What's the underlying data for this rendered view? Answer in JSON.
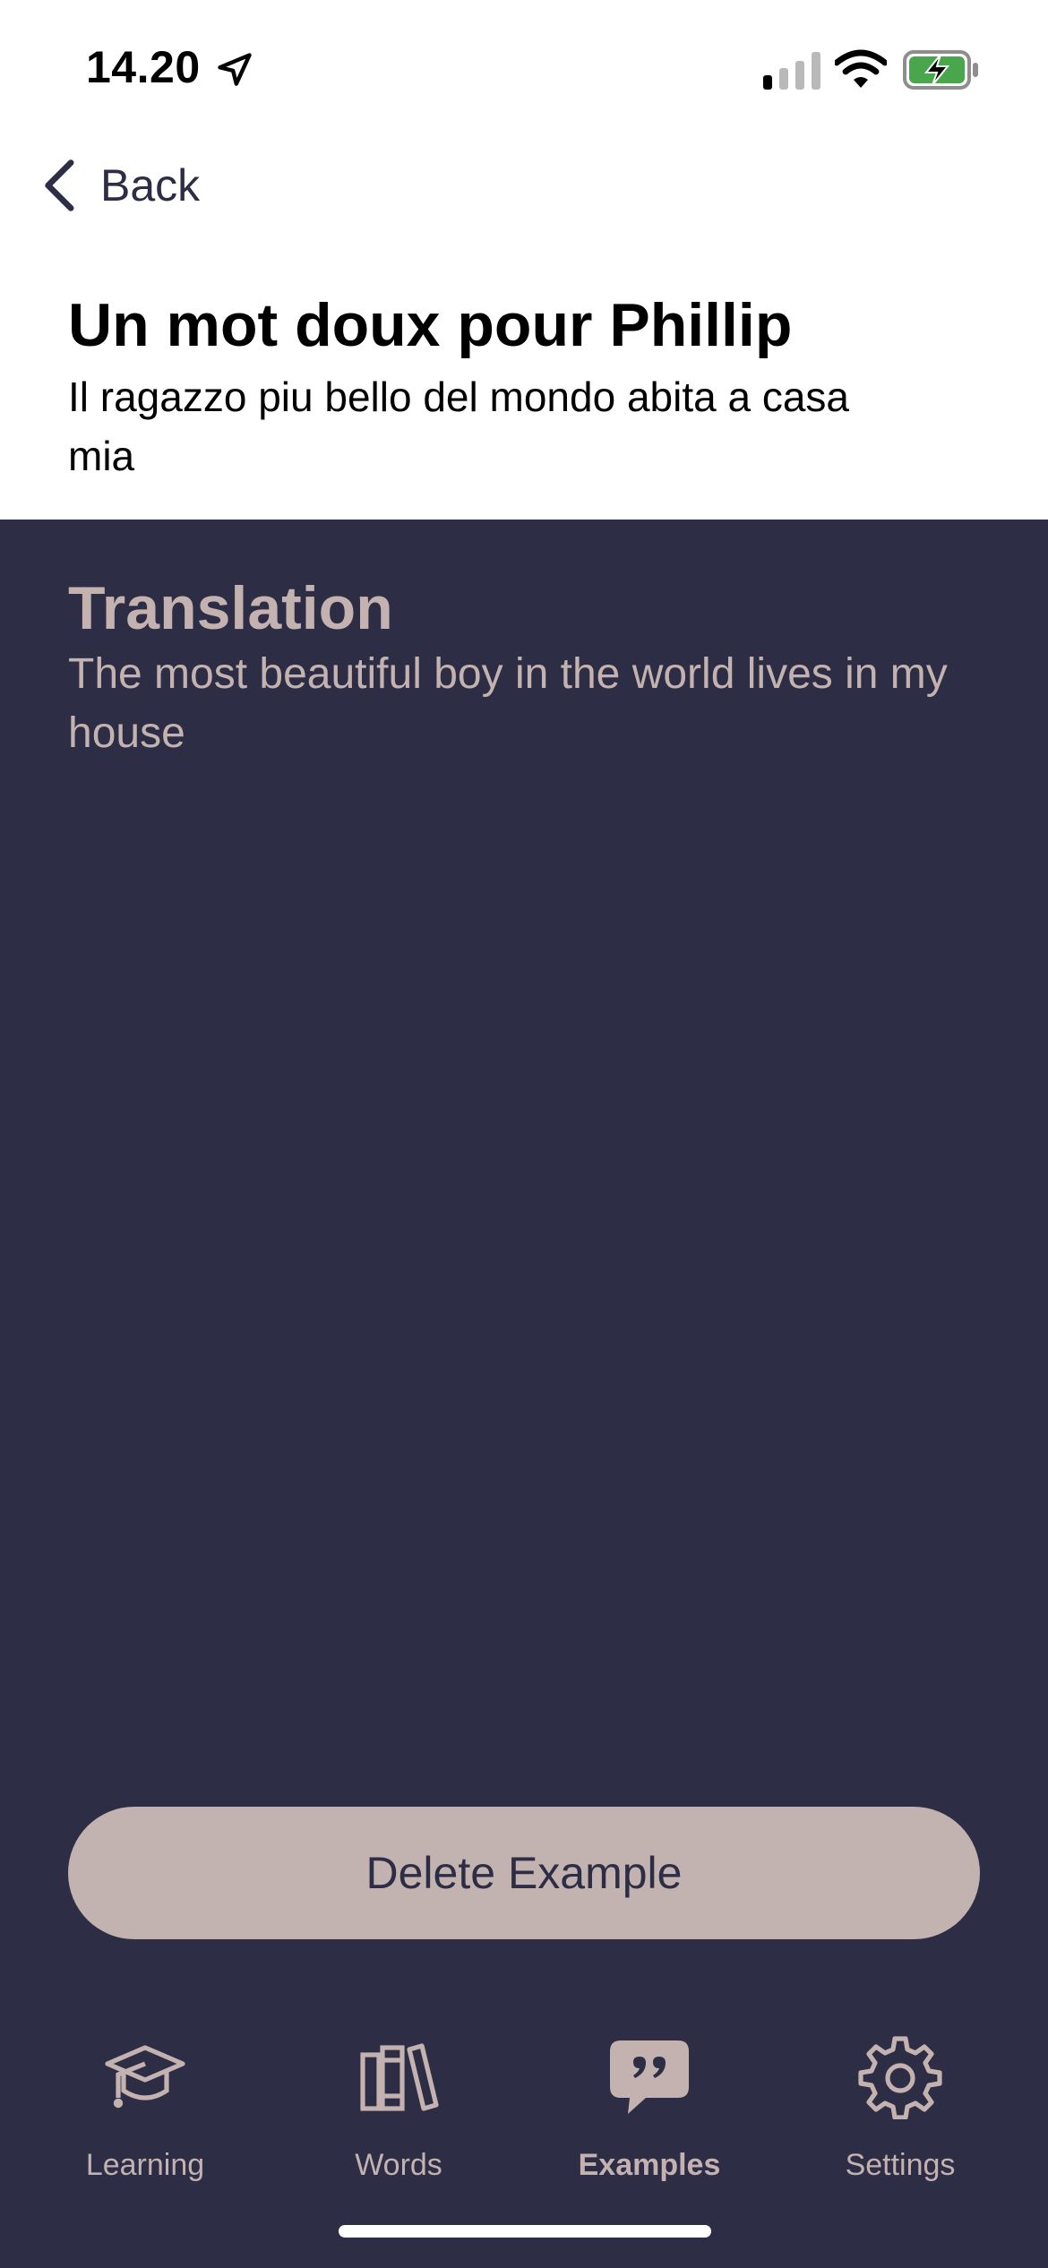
{
  "status_bar": {
    "time": "14.20"
  },
  "nav": {
    "back_label": "Back"
  },
  "example": {
    "title": "Un mot doux pour Phillip",
    "text": "Il ragazzo piu bello del mondo abita a casa mia"
  },
  "translation": {
    "heading": "Translation",
    "text": "The most beautiful boy in the world lives in my house"
  },
  "actions": {
    "delete_label": "Delete Example"
  },
  "tabs": [
    {
      "label": "Learning",
      "icon": "graduation-cap-icon",
      "active": false
    },
    {
      "label": "Words",
      "icon": "books-icon",
      "active": false
    },
    {
      "label": "Examples",
      "icon": "quote-bubble-icon",
      "active": true
    },
    {
      "label": "Settings",
      "icon": "gear-icon",
      "active": false
    }
  ],
  "colors": {
    "primary_dark": "#2d2e45",
    "accent": "#c3b2b0",
    "battery": "#4aa64c"
  }
}
